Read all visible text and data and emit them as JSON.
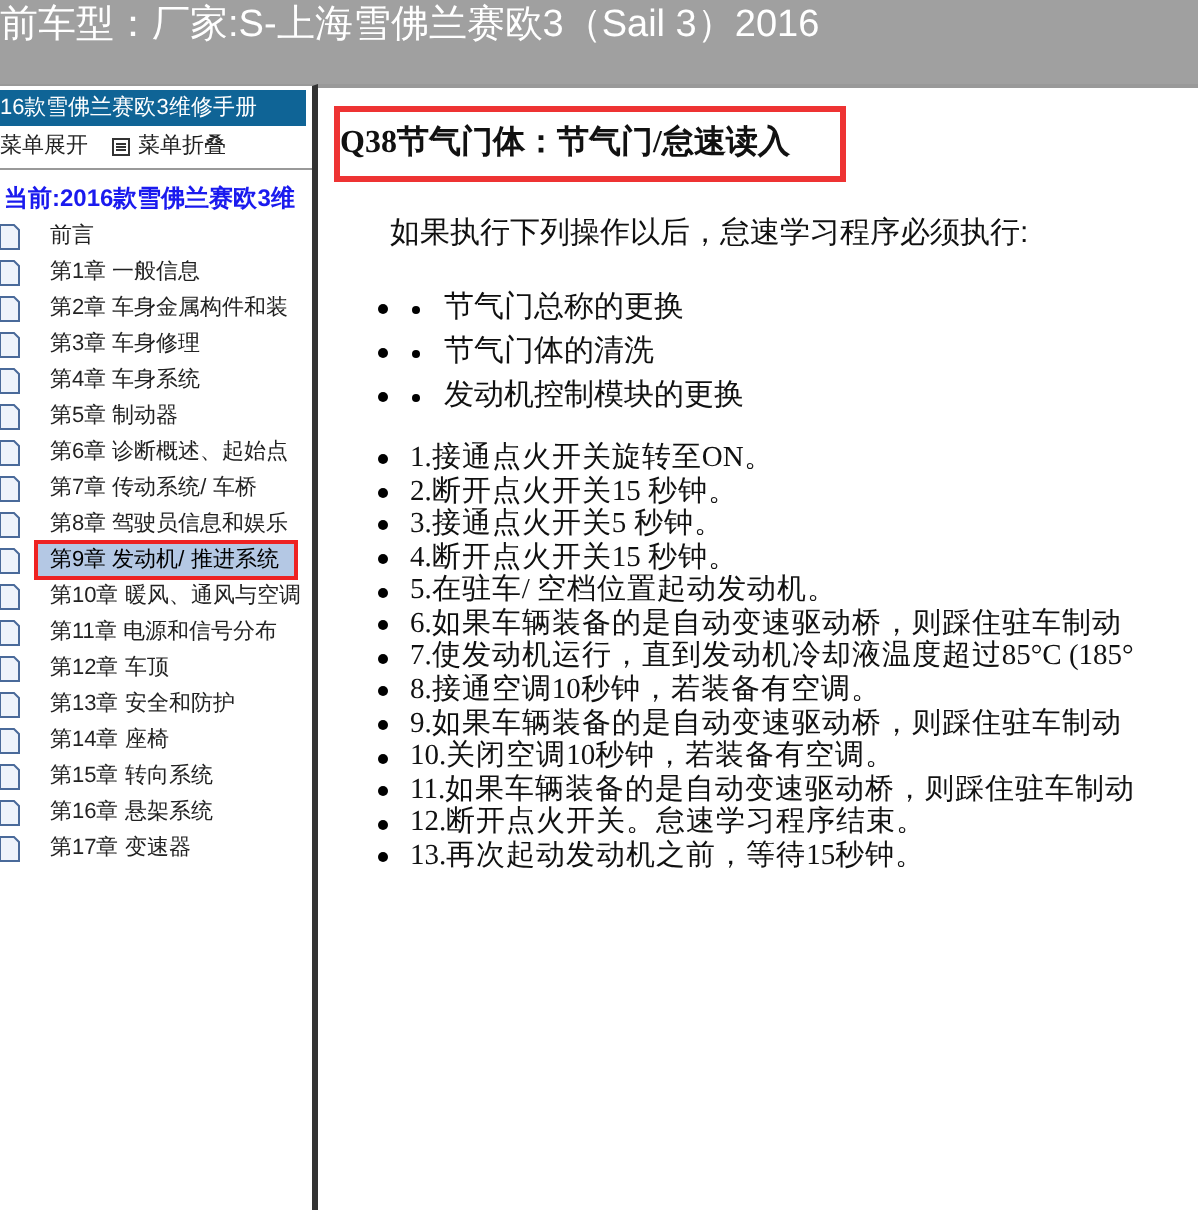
{
  "window": {
    "title": "前车型：厂家:S-上海雪佛兰赛欧3（Sail 3）2016"
  },
  "sidebar": {
    "header": "16款雪佛兰赛欧3维修手册",
    "expand_label": "菜单展开",
    "collapse_label": "菜单折叠",
    "current": "当前:2016款雪佛兰赛欧3维",
    "items": [
      {
        "label": "前言",
        "selected": false
      },
      {
        "label": "第1章 一般信息",
        "selected": false
      },
      {
        "label": "第2章 车身金属构件和装",
        "selected": false
      },
      {
        "label": "第3章 车身修理",
        "selected": false
      },
      {
        "label": "第4章 车身系统",
        "selected": false
      },
      {
        "label": "第5章 制动器",
        "selected": false
      },
      {
        "label": "第6章 诊断概述、起始点",
        "selected": false
      },
      {
        "label": "第7章 传动系统/ 车桥",
        "selected": false
      },
      {
        "label": "第8章 驾驶员信息和娱乐",
        "selected": false
      },
      {
        "label": "第9章 发动机/ 推进系统",
        "selected": true
      },
      {
        "label": "第10章 暖风、通风与空调",
        "selected": false
      },
      {
        "label": "第11章 电源和信号分布",
        "selected": false
      },
      {
        "label": "第12章 车顶",
        "selected": false
      },
      {
        "label": "第13章 安全和防护",
        "selected": false
      },
      {
        "label": "第14章 座椅",
        "selected": false
      },
      {
        "label": "第15章 转向系统",
        "selected": false
      },
      {
        "label": "第16章 悬架系统",
        "selected": false
      },
      {
        "label": "第17章 变速器",
        "selected": false
      }
    ]
  },
  "content": {
    "heading": "Q38节气门体：节气门/怠速读入",
    "intro": "如果执行下列操作以后，怠速学习程序必须执行:",
    "conditions": [
      "节气门总称的更换",
      "节气门体的清洗",
      "发动机控制模块的更换"
    ],
    "steps": [
      "1.接通点火开关旋转至ON。",
      "2.断开点火开关15 秒钟。",
      "3.接通点火开关5 秒钟。",
      "4.断开点火开关15 秒钟。",
      "5.在驻车/ 空档位置起动发动机。",
      "6.如果车辆装备的是自动变速驱动桥，则踩住驻车制动",
      "7.使发动机运行，直到发动机冷却液温度超过85°C (185°",
      "8.接通空调10秒钟，若装备有空调。",
      "9.如果车辆装备的是自动变速驱动桥，则踩住驻车制动",
      "10.关闭空调10秒钟，若装备有空调。",
      "11.如果车辆装备的是自动变速驱动桥，则踩住驻车制动",
      "12.断开点火开关。怠速学习程序结束。",
      "13.再次起动发动机之前，等待15秒钟。"
    ]
  }
}
